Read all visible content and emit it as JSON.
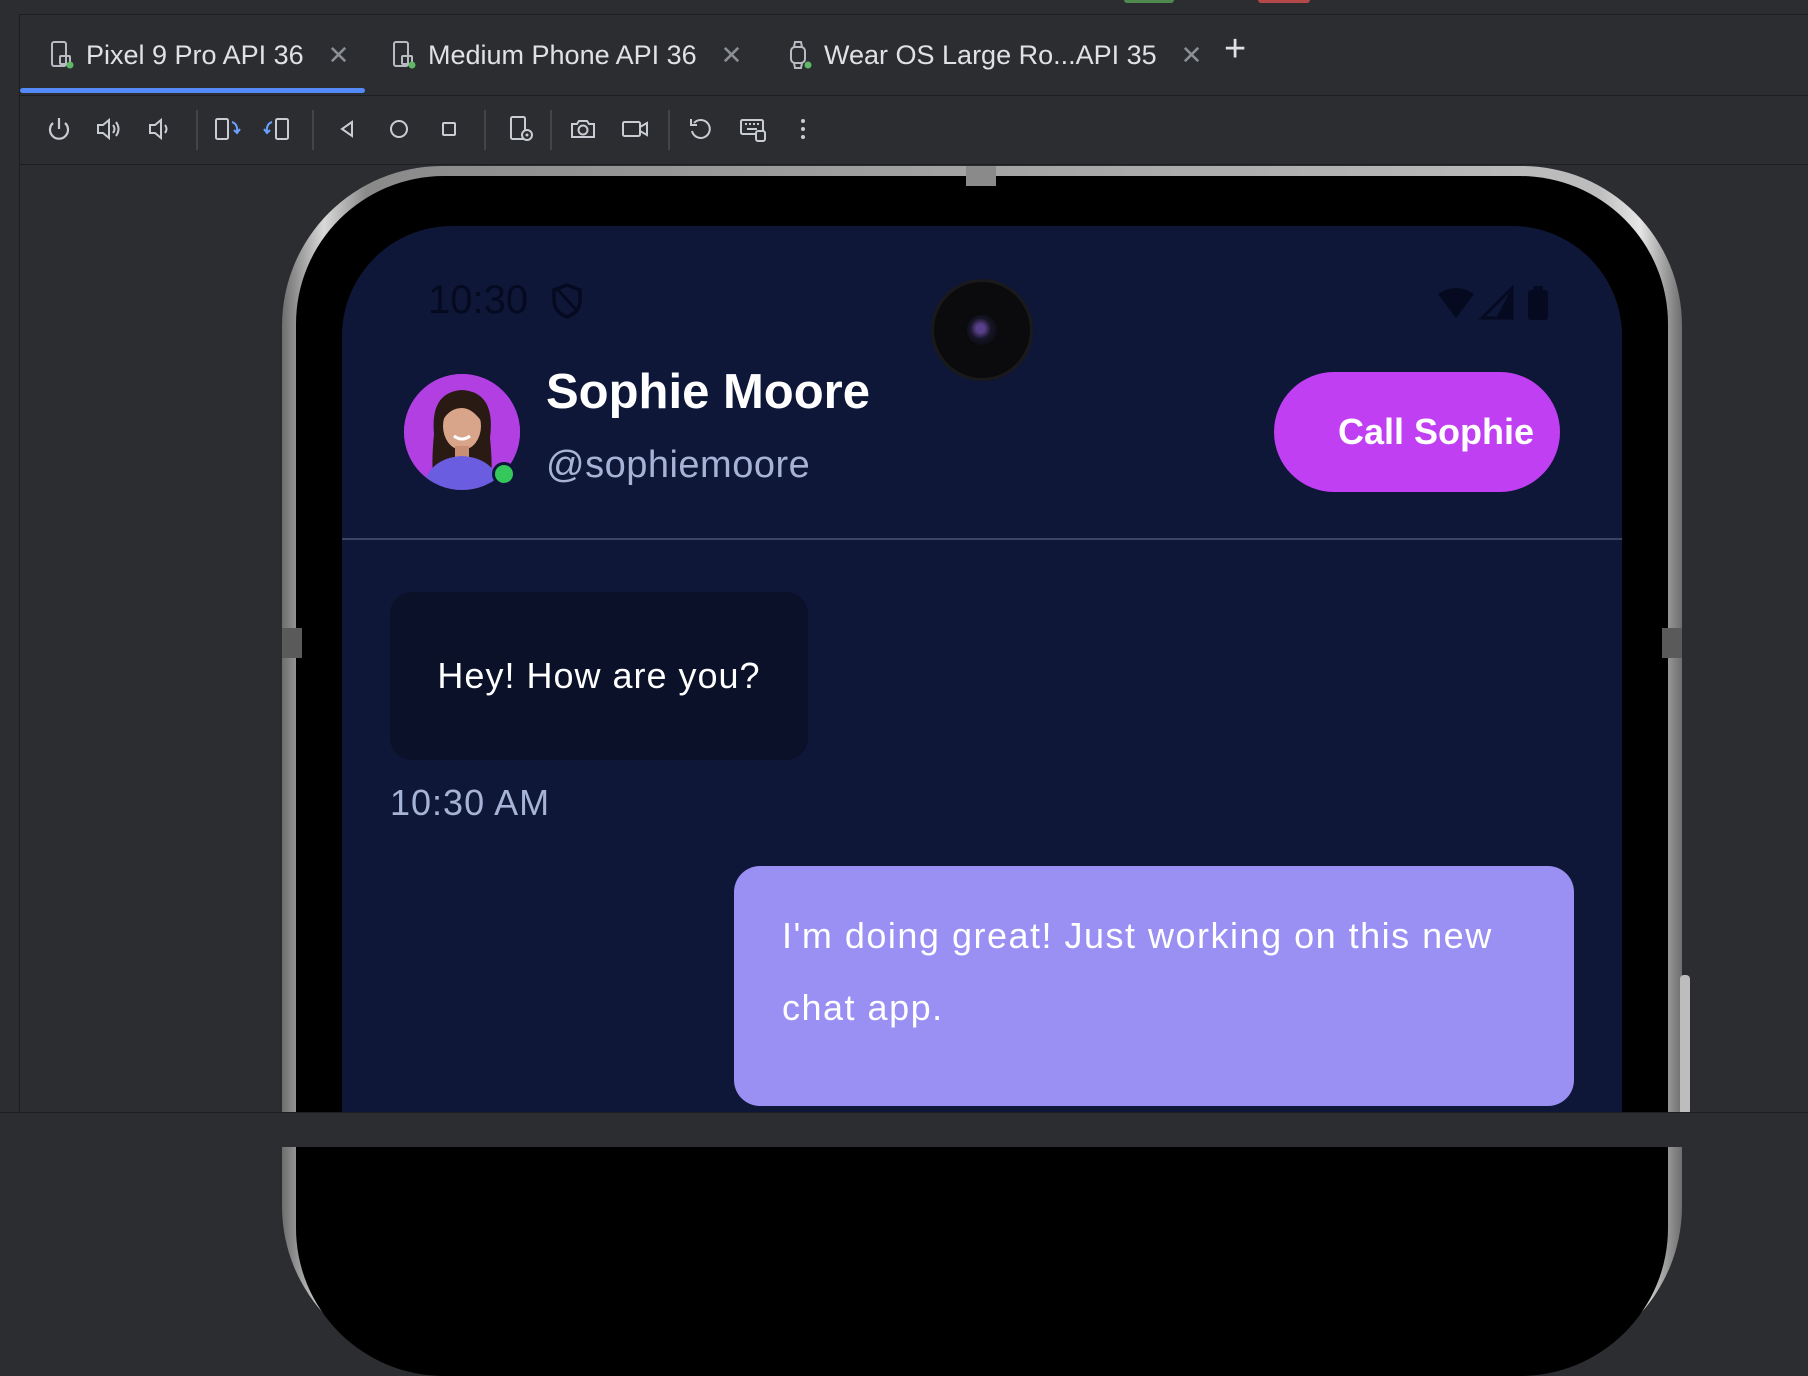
{
  "tabs": [
    {
      "label": "Pixel 9 Pro API 36",
      "icon": "phone-device-icon",
      "active": true
    },
    {
      "label": "Medium Phone API 36",
      "icon": "phone-device-icon",
      "active": false
    },
    {
      "label": "Wear OS Large Ro...API 35",
      "icon": "watch-device-icon",
      "active": false
    }
  ],
  "colors": {
    "ide_bg": "#2b2d30",
    "tab_underline": "#548af7",
    "screen_bg": "#0e1738",
    "call_button": "#c03ff2",
    "incoming_bubble": "#0a1129",
    "outgoing_bubble": "#9a8ff2"
  },
  "toolbar": {
    "icons": [
      "power-icon",
      "volume-up-icon",
      "volume-down-icon",
      "rotate-left-icon",
      "rotate-right-icon",
      "back-icon",
      "home-icon",
      "overview-icon",
      "device-settings-icon",
      "camera-icon",
      "video-record-icon",
      "reset-icon",
      "keyboard-icon",
      "more-options-icon"
    ]
  },
  "status": {
    "time": "10:30"
  },
  "contact": {
    "name": "Sophie Moore",
    "handle": "@sophiemoore",
    "call_label": "Call Sophie"
  },
  "messages": {
    "incoming_text": "Hey! How are you?",
    "incoming_time": "10:30 AM",
    "outgoing_text": "I'm doing great! Just working on this new chat app."
  }
}
